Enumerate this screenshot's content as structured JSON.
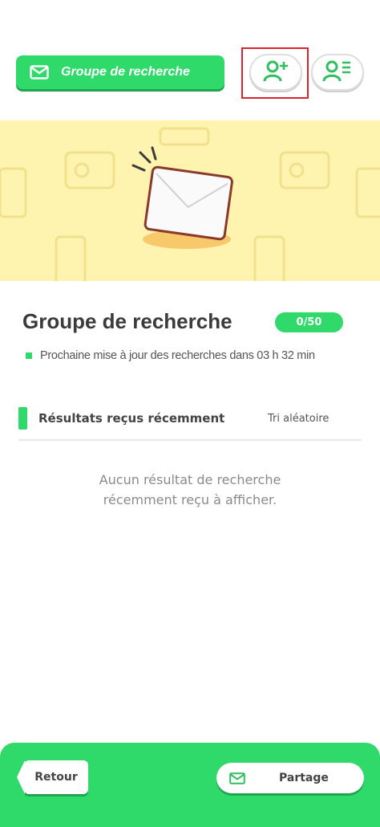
{
  "header": {
    "title": "Groupe de recherche",
    "title_icon": "envelope-icon",
    "add_friend_icon": "person-add-icon",
    "friend_list_icon": "person-list-icon"
  },
  "banner": {
    "illustration": "envelope-illustration"
  },
  "group": {
    "title": "Groupe de recherche",
    "count": "0/50",
    "next_update": "Prochaine mise à jour des recherches dans 03 h 32 min"
  },
  "results": {
    "header": "Résultats reçus récemment",
    "sort_label": "Tri aléatoire",
    "empty_line1": "Aucun résultat de recherche",
    "empty_line2": "récemment reçu à afficher."
  },
  "footer": {
    "back_label": "Retour",
    "share_label": "Partage",
    "share_icon": "envelope-icon"
  },
  "colors": {
    "accent_green": "#2fd96a",
    "banner_yellow": "#fff3b0",
    "highlight_red": "#d9232d"
  }
}
